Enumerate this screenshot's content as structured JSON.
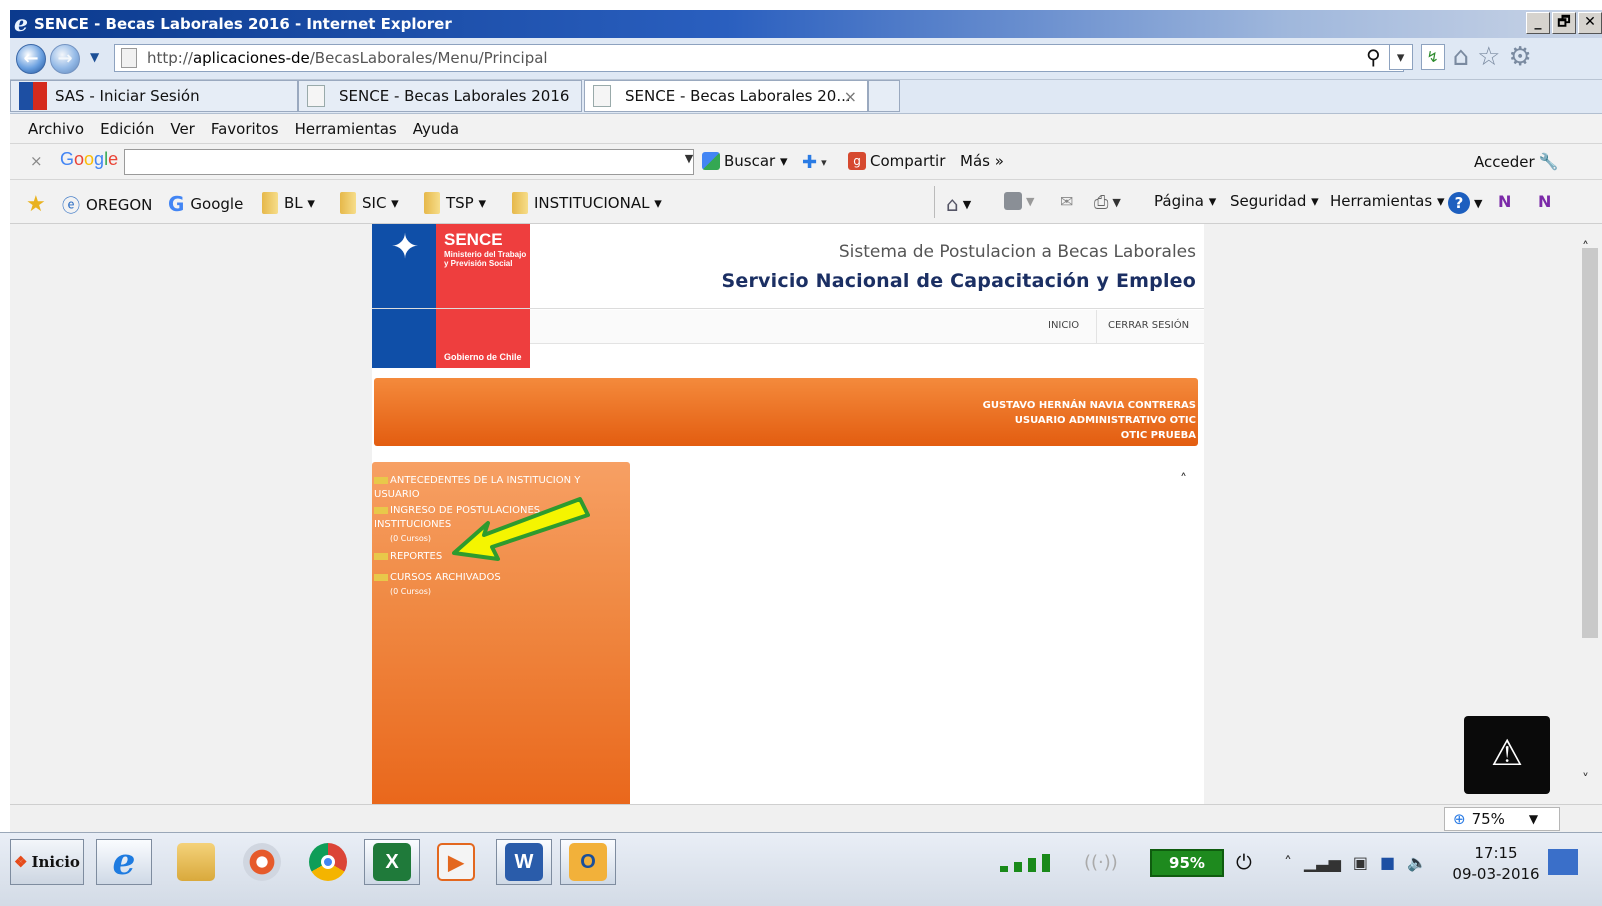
{
  "window": {
    "title": "SENCE - Becas Laborales 2016 - Internet Explorer",
    "controls": [
      "_",
      "🗗",
      "✕"
    ]
  },
  "address": {
    "url_host": "http://",
    "url_domain": "aplicaciones-de",
    "url_path": "/BecasLaborales/Menu/Principal"
  },
  "tabs": [
    {
      "label": "SAS - Iniciar Sesión"
    },
    {
      "label": "SENCE - Becas Laborales 2016"
    },
    {
      "label": "SENCE - Becas Laborales 20...",
      "close": "×"
    }
  ],
  "menubar": [
    "Archivo",
    "Edición",
    "Ver",
    "Favoritos",
    "Herramientas",
    "Ayuda"
  ],
  "google_toolbar": {
    "close": "×",
    "logo": [
      "G",
      "o",
      "o",
      "g",
      "l",
      "e"
    ],
    "search_value": "",
    "buscar": "Buscar ▾",
    "compartir": "Compartir",
    "mas": "Más »",
    "acceder": "Acceder"
  },
  "favorites": [
    {
      "label": "OREGON"
    },
    {
      "label": "Google"
    },
    {
      "label": "BL ▾"
    },
    {
      "label": "SIC ▾"
    },
    {
      "label": "TSP ▾"
    },
    {
      "label": "INSTITUCIONAL ▾"
    }
  ],
  "command_bar": {
    "pagina": "Página ▾",
    "seguridad": "Seguridad ▾",
    "herramientas": "Herramientas ▾"
  },
  "site": {
    "logo_title": "SENCE",
    "logo_subtitle": "Ministerio del Trabajo y Previsión Social",
    "logo_footer": "Gobierno de Chile",
    "header_line1": "Sistema de Postulacion a Becas Laborales",
    "header_line2": "Servicio Nacional de Capacitación y Empleo",
    "nav_inicio": "INICIO",
    "nav_cerrar": "CERRAR SESIÓN",
    "user_name": "GUSTAVO HERNÁN NAVIA CONTRERAS",
    "user_role": "USUARIO ADMINISTRATIVO OTIC",
    "user_org": "OTIC PRUEBA",
    "collapse_icon": "˄"
  },
  "side_menu": [
    {
      "label": "ANTECEDENTES DE LA INSTITUCION Y USUARIO",
      "sub": ""
    },
    {
      "label": "INGRESO DE POSTULACIONES INSTITUCIONES",
      "sub": "(0 Cursos)"
    },
    {
      "label": "REPORTES",
      "sub": ""
    },
    {
      "label": "CURSOS ARCHIVADOS",
      "sub": "(0 Cursos)"
    }
  ],
  "status": {
    "zoom": "75%"
  },
  "taskbar": {
    "start": "Inicio",
    "battery": "95%",
    "time": "17:15",
    "date": "09-03-2016"
  },
  "colors": {
    "banner": "#e35d10",
    "menu": "#f08a44",
    "title": "#1b2f63",
    "arrow": "#f5f500"
  }
}
